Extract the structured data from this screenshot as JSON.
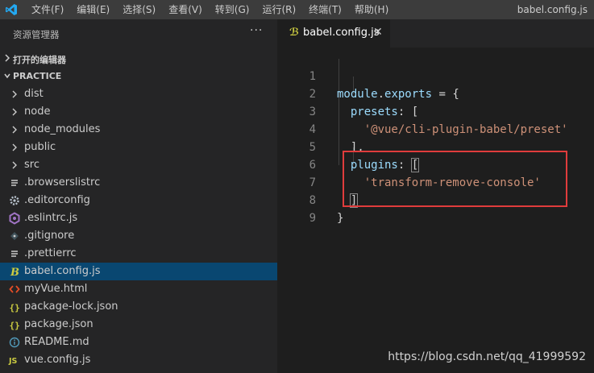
{
  "titlebar": {
    "menu": [
      "文件(F)",
      "编辑(E)",
      "选择(S)",
      "查看(V)",
      "转到(G)",
      "运行(R)",
      "终端(T)",
      "帮助(H)"
    ],
    "window_title": "babel.config.js"
  },
  "sidebar": {
    "header": "资源管理器",
    "more": "···",
    "open_editors": "打开的编辑器",
    "project": "PRACTICE",
    "items": [
      {
        "name": "dist",
        "icon": "chevron-right",
        "type": "folder"
      },
      {
        "name": "node",
        "icon": "chevron-right",
        "type": "folder"
      },
      {
        "name": "node_modules",
        "icon": "chevron-right",
        "type": "folder"
      },
      {
        "name": "public",
        "icon": "chevron-right",
        "type": "folder"
      },
      {
        "name": "src",
        "icon": "chevron-right",
        "type": "folder"
      },
      {
        "name": ".browserslistrc",
        "icon": "lines-icon",
        "type": "file"
      },
      {
        "name": ".editorconfig",
        "icon": "gear-icon",
        "type": "file"
      },
      {
        "name": ".eslintrc.js",
        "icon": "eslint-icon",
        "type": "file"
      },
      {
        "name": ".gitignore",
        "icon": "git-icon",
        "type": "file"
      },
      {
        "name": ".prettierrc",
        "icon": "lines-icon",
        "type": "file"
      },
      {
        "name": "babel.config.js",
        "icon": "babel-icon",
        "type": "file",
        "selected": true
      },
      {
        "name": "myVue.html",
        "icon": "html-icon",
        "type": "file"
      },
      {
        "name": "package-lock.json",
        "icon": "json-icon",
        "type": "file"
      },
      {
        "name": "package.json",
        "icon": "json-icon",
        "type": "file"
      },
      {
        "name": "README.md",
        "icon": "info-icon",
        "type": "file"
      },
      {
        "name": "vue.config.js",
        "icon": "js-icon",
        "type": "file"
      }
    ]
  },
  "editor": {
    "tab": {
      "name": "babel.config.js",
      "close": "✕"
    },
    "lines": [
      {
        "n": "1",
        "text": "module.exports = {"
      },
      {
        "n": "2",
        "text": "  presets: ["
      },
      {
        "n": "3",
        "text": "    '@vue/cli-plugin-babel/preset'"
      },
      {
        "n": "4",
        "text": "  ],"
      },
      {
        "n": "5",
        "text": "  plugins: ["
      },
      {
        "n": "6",
        "text": "    'transform-remove-console'"
      },
      {
        "n": "7",
        "text": "  ]"
      },
      {
        "n": "8",
        "text": "}"
      },
      {
        "n": "9",
        "text": ""
      }
    ]
  },
  "watermark": "https://blog.csdn.net/qq_41999592",
  "colors": {
    "accent": "#094771",
    "highlight_box": "#e03c3c",
    "string": "#ce9178",
    "identifier": "#9cdcfe"
  }
}
